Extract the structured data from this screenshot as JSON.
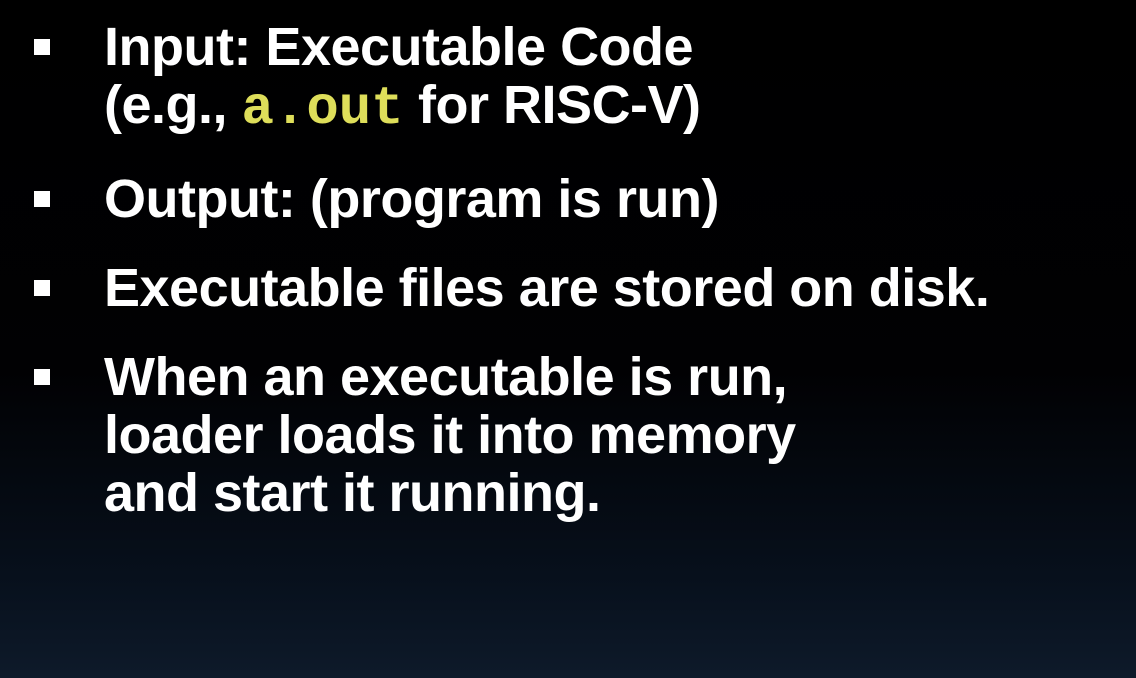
{
  "bullets": [
    {
      "line1": "Input: Executable Code",
      "line2_prefix": "(e.g., ",
      "line2_code": "a.out",
      "line2_suffix": " for RISC-V)"
    },
    {
      "line1": "Output: (program is run)"
    },
    {
      "line1": "Executable files are stored on disk."
    },
    {
      "line1": "When an executable is run,",
      "line2": "loader loads it into memory",
      "line3": "and start it running."
    }
  ],
  "colors": {
    "text": "#ffffff",
    "code": "#dede5a",
    "background": "#000000"
  }
}
